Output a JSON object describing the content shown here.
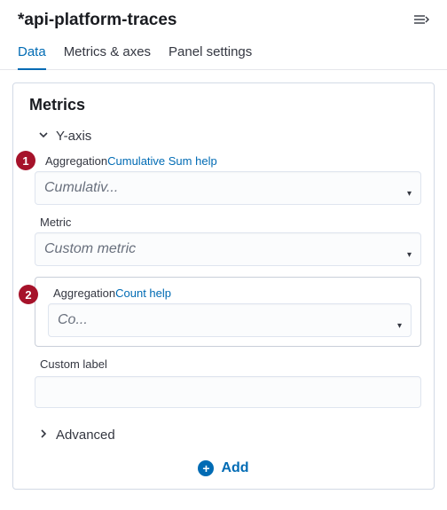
{
  "header": {
    "title": "*api-platform-traces"
  },
  "tabs": {
    "data": "Data",
    "metrics_axes": "Metrics & axes",
    "panel_settings": "Panel settings"
  },
  "panel": {
    "title": "Metrics",
    "yaxis_label": "Y-axis",
    "advanced_label": "Advanced",
    "add_label": "Add"
  },
  "agg1": {
    "badge": "1",
    "label": "Aggregation",
    "help": "Cumulative Sum help",
    "value": "Cumulativ...",
    "metric_label": "Metric",
    "metric_value": "Custom metric"
  },
  "agg2": {
    "badge": "2",
    "label": "Aggregation",
    "help": "Count help",
    "value": "Co..."
  },
  "custom_label": {
    "label": "Custom label",
    "value": ""
  }
}
